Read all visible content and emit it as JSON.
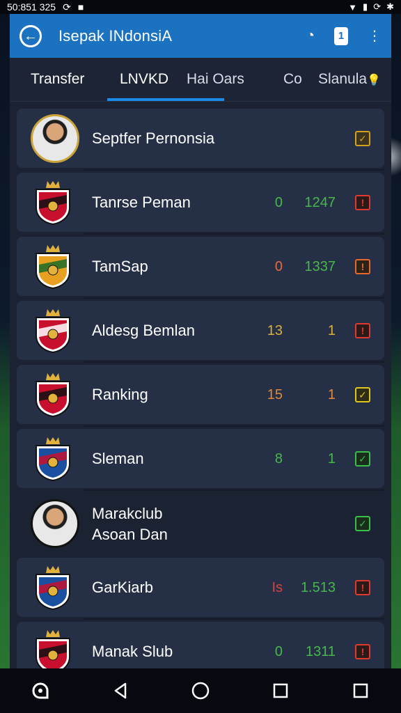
{
  "status_bar": {
    "time": "50:851 325"
  },
  "app_bar": {
    "title": "Isepak INdonsiA"
  },
  "tabs": [
    {
      "label": "Transfer"
    },
    {
      "label": "LNVKD"
    },
    {
      "label": "Hai  Oars"
    },
    {
      "label": "Co"
    },
    {
      "label": "Slanula"
    }
  ],
  "list": [
    {
      "name": "Septfer Pernonsia",
      "stat1": "",
      "stat2": "",
      "kind": "avatar",
      "icon_color": "#d4a11e",
      "icon_bg": "#3a3420",
      "stat1_color": "#47b84a",
      "stat2_color": "#47b84a"
    },
    {
      "name": "Tanrse Peman",
      "stat1": "0",
      "stat2": "1247",
      "kind": "crest",
      "icon_color": "#e03a2f",
      "icon_bg": "#2b1a1a",
      "stat1_color": "#47b84a",
      "stat2_color": "#47b84a"
    },
    {
      "name": "TamSap",
      "stat1": "0",
      "stat2": "1337",
      "kind": "crest",
      "icon_color": "#e66a2a",
      "icon_bg": "#2b221a",
      "stat1_color": "#e76a3a",
      "stat2_color": "#47b84a"
    },
    {
      "name": "Aldesg Bemlan",
      "stat1": "13",
      "stat2": "1",
      "kind": "crest",
      "icon_color": "#e03a2f",
      "icon_bg": "#2b1a1a",
      "stat1_color": "#d9b03a",
      "stat2_color": "#d9b03a"
    },
    {
      "name": "Ranking",
      "stat1": "15",
      "stat2": "1",
      "kind": "crest",
      "icon_color": "#e0c51e",
      "icon_bg": "#2f2c18",
      "stat1_color": "#e08a3a",
      "stat2_color": "#e08a3a"
    },
    {
      "name": "Sleman",
      "stat1": "8",
      "stat2": "1",
      "kind": "crest",
      "icon_color": "#3bbf4c",
      "icon_bg": "#1a2d1c",
      "stat1_color": "#47b84a",
      "stat2_color": "#47b84a"
    },
    {
      "name": "Marakclub\nAsoan Dan",
      "stat1": "",
      "stat2": "",
      "kind": "avatar",
      "icon_color": "#3bbf4c",
      "icon_bg": "#1a2d1c",
      "stat1_color": "#47b84a",
      "stat2_color": "#47b84a"
    },
    {
      "name": "GarKiarb",
      "stat1": "Is",
      "stat2": "1.513",
      "kind": "crest",
      "icon_color": "#e03a2f",
      "icon_bg": "#2b1a1a",
      "stat1_color": "#d9423a",
      "stat2_color": "#47b84a"
    },
    {
      "name": "Manak Slub",
      "stat1": "0",
      "stat2": "1311",
      "kind": "crest",
      "icon_color": "#e03a2f",
      "icon_bg": "#2b1a1a",
      "stat1_color": "#47b84a",
      "stat2_color": "#47b84a"
    }
  ],
  "nav_bar": [
    {
      "icon": "home-app-icon"
    },
    {
      "icon": "back-triangle-icon"
    },
    {
      "icon": "home-circle-icon"
    },
    {
      "icon": "recents-square-icon"
    },
    {
      "icon": "square-icon"
    }
  ]
}
